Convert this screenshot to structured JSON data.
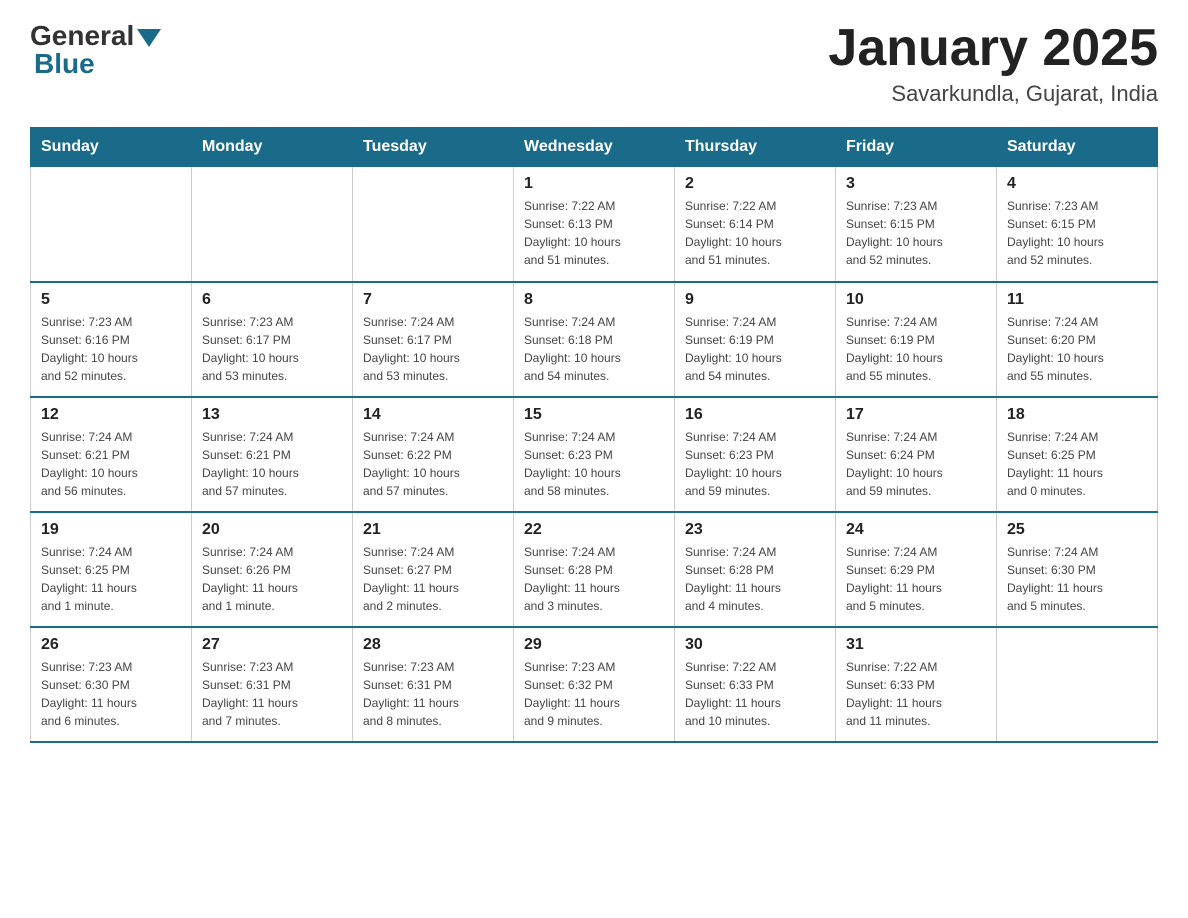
{
  "header": {
    "logo_general": "General",
    "logo_blue": "Blue",
    "title": "January 2025",
    "subtitle": "Savarkundla, Gujarat, India"
  },
  "days_of_week": [
    "Sunday",
    "Monday",
    "Tuesday",
    "Wednesday",
    "Thursday",
    "Friday",
    "Saturday"
  ],
  "weeks": [
    [
      {
        "day": "",
        "info": ""
      },
      {
        "day": "",
        "info": ""
      },
      {
        "day": "",
        "info": ""
      },
      {
        "day": "1",
        "info": "Sunrise: 7:22 AM\nSunset: 6:13 PM\nDaylight: 10 hours\nand 51 minutes."
      },
      {
        "day": "2",
        "info": "Sunrise: 7:22 AM\nSunset: 6:14 PM\nDaylight: 10 hours\nand 51 minutes."
      },
      {
        "day": "3",
        "info": "Sunrise: 7:23 AM\nSunset: 6:15 PM\nDaylight: 10 hours\nand 52 minutes."
      },
      {
        "day": "4",
        "info": "Sunrise: 7:23 AM\nSunset: 6:15 PM\nDaylight: 10 hours\nand 52 minutes."
      }
    ],
    [
      {
        "day": "5",
        "info": "Sunrise: 7:23 AM\nSunset: 6:16 PM\nDaylight: 10 hours\nand 52 minutes."
      },
      {
        "day": "6",
        "info": "Sunrise: 7:23 AM\nSunset: 6:17 PM\nDaylight: 10 hours\nand 53 minutes."
      },
      {
        "day": "7",
        "info": "Sunrise: 7:24 AM\nSunset: 6:17 PM\nDaylight: 10 hours\nand 53 minutes."
      },
      {
        "day": "8",
        "info": "Sunrise: 7:24 AM\nSunset: 6:18 PM\nDaylight: 10 hours\nand 54 minutes."
      },
      {
        "day": "9",
        "info": "Sunrise: 7:24 AM\nSunset: 6:19 PM\nDaylight: 10 hours\nand 54 minutes."
      },
      {
        "day": "10",
        "info": "Sunrise: 7:24 AM\nSunset: 6:19 PM\nDaylight: 10 hours\nand 55 minutes."
      },
      {
        "day": "11",
        "info": "Sunrise: 7:24 AM\nSunset: 6:20 PM\nDaylight: 10 hours\nand 55 minutes."
      }
    ],
    [
      {
        "day": "12",
        "info": "Sunrise: 7:24 AM\nSunset: 6:21 PM\nDaylight: 10 hours\nand 56 minutes."
      },
      {
        "day": "13",
        "info": "Sunrise: 7:24 AM\nSunset: 6:21 PM\nDaylight: 10 hours\nand 57 minutes."
      },
      {
        "day": "14",
        "info": "Sunrise: 7:24 AM\nSunset: 6:22 PM\nDaylight: 10 hours\nand 57 minutes."
      },
      {
        "day": "15",
        "info": "Sunrise: 7:24 AM\nSunset: 6:23 PM\nDaylight: 10 hours\nand 58 minutes."
      },
      {
        "day": "16",
        "info": "Sunrise: 7:24 AM\nSunset: 6:23 PM\nDaylight: 10 hours\nand 59 minutes."
      },
      {
        "day": "17",
        "info": "Sunrise: 7:24 AM\nSunset: 6:24 PM\nDaylight: 10 hours\nand 59 minutes."
      },
      {
        "day": "18",
        "info": "Sunrise: 7:24 AM\nSunset: 6:25 PM\nDaylight: 11 hours\nand 0 minutes."
      }
    ],
    [
      {
        "day": "19",
        "info": "Sunrise: 7:24 AM\nSunset: 6:25 PM\nDaylight: 11 hours\nand 1 minute."
      },
      {
        "day": "20",
        "info": "Sunrise: 7:24 AM\nSunset: 6:26 PM\nDaylight: 11 hours\nand 1 minute."
      },
      {
        "day": "21",
        "info": "Sunrise: 7:24 AM\nSunset: 6:27 PM\nDaylight: 11 hours\nand 2 minutes."
      },
      {
        "day": "22",
        "info": "Sunrise: 7:24 AM\nSunset: 6:28 PM\nDaylight: 11 hours\nand 3 minutes."
      },
      {
        "day": "23",
        "info": "Sunrise: 7:24 AM\nSunset: 6:28 PM\nDaylight: 11 hours\nand 4 minutes."
      },
      {
        "day": "24",
        "info": "Sunrise: 7:24 AM\nSunset: 6:29 PM\nDaylight: 11 hours\nand 5 minutes."
      },
      {
        "day": "25",
        "info": "Sunrise: 7:24 AM\nSunset: 6:30 PM\nDaylight: 11 hours\nand 5 minutes."
      }
    ],
    [
      {
        "day": "26",
        "info": "Sunrise: 7:23 AM\nSunset: 6:30 PM\nDaylight: 11 hours\nand 6 minutes."
      },
      {
        "day": "27",
        "info": "Sunrise: 7:23 AM\nSunset: 6:31 PM\nDaylight: 11 hours\nand 7 minutes."
      },
      {
        "day": "28",
        "info": "Sunrise: 7:23 AM\nSunset: 6:31 PM\nDaylight: 11 hours\nand 8 minutes."
      },
      {
        "day": "29",
        "info": "Sunrise: 7:23 AM\nSunset: 6:32 PM\nDaylight: 11 hours\nand 9 minutes."
      },
      {
        "day": "30",
        "info": "Sunrise: 7:22 AM\nSunset: 6:33 PM\nDaylight: 11 hours\nand 10 minutes."
      },
      {
        "day": "31",
        "info": "Sunrise: 7:22 AM\nSunset: 6:33 PM\nDaylight: 11 hours\nand 11 minutes."
      },
      {
        "day": "",
        "info": ""
      }
    ]
  ]
}
